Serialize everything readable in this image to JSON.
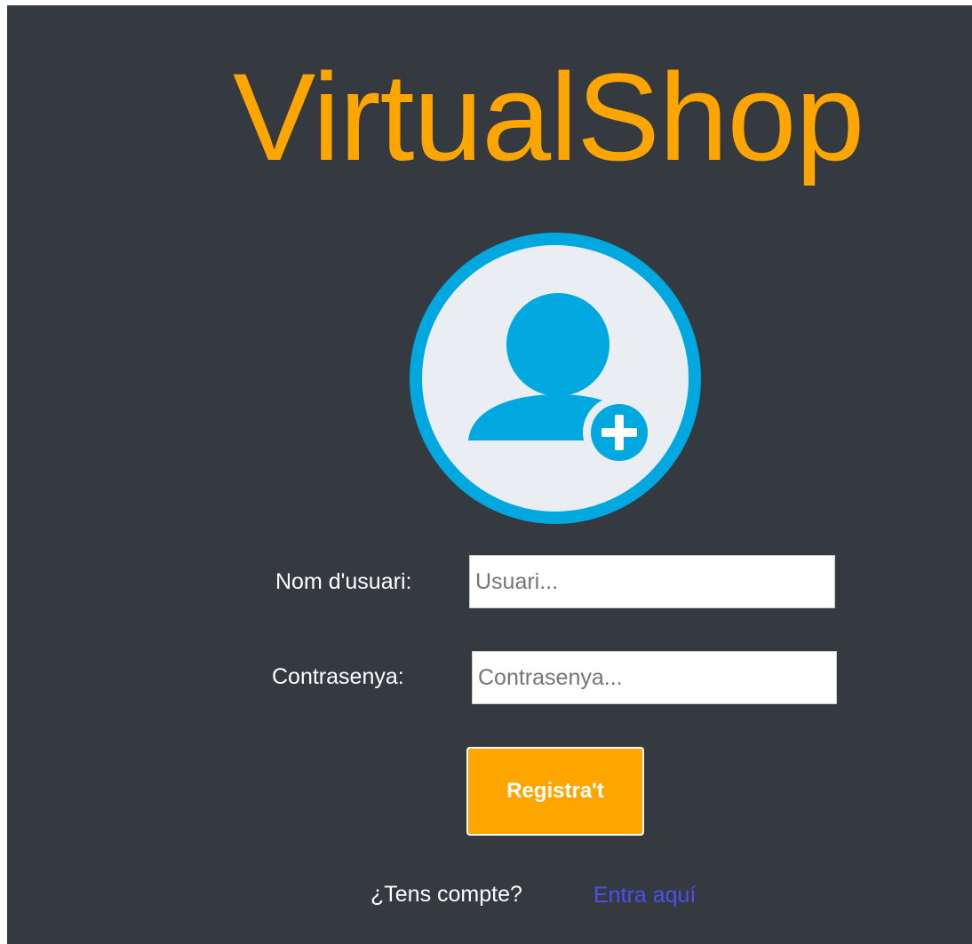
{
  "brand": {
    "title": "VirtualShop",
    "accent_color": "#ffa500"
  },
  "avatar": {
    "icon": "add-user-icon",
    "ring_color": "#00a8e0"
  },
  "form": {
    "username_label": "Nom d'usuari:",
    "username_placeholder": "Usuari...",
    "password_label": "Contrasenya:",
    "password_placeholder": "Contrasenya...",
    "submit_label": "Registra't"
  },
  "footer": {
    "question": "¿Tens compte?",
    "login_link": "Entra aquí"
  }
}
